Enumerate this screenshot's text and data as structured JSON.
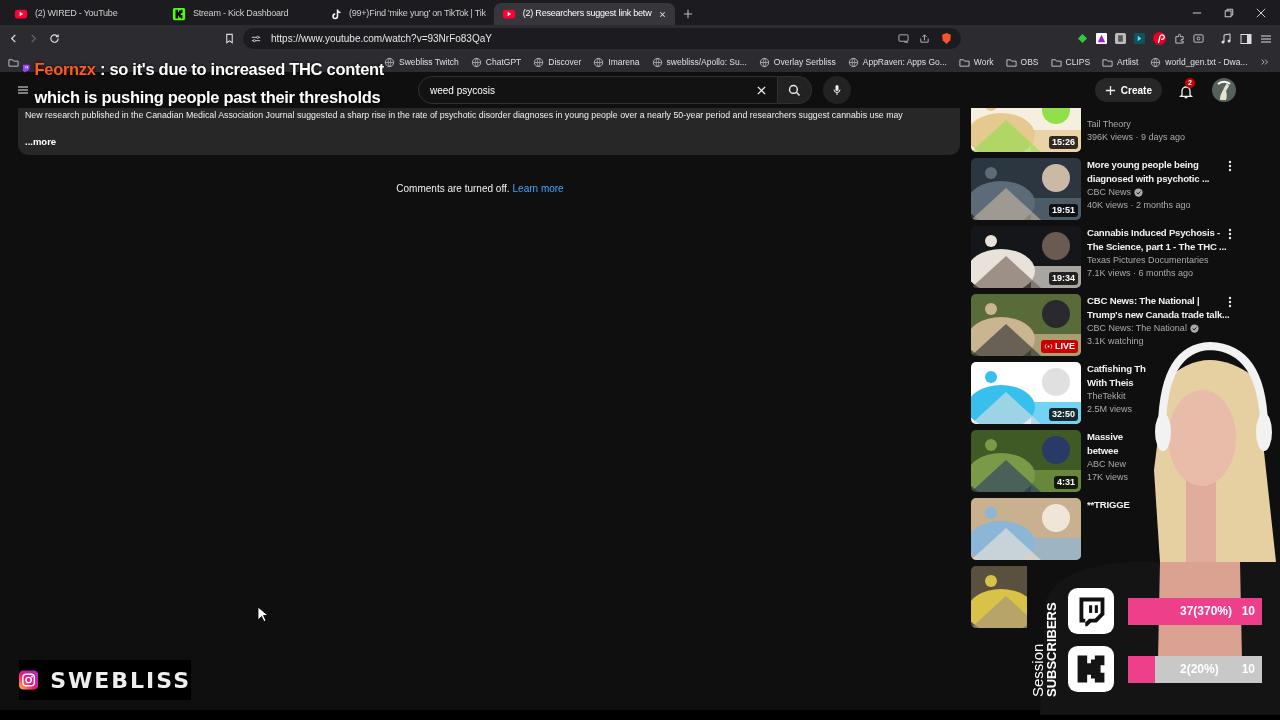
{
  "browser": {
    "tabs": [
      {
        "title": "(2) WIRED - YouTube",
        "selected": false
      },
      {
        "title": "Stream - Kick Dashboard",
        "selected": false
      },
      {
        "title": "(99+)Find 'mike yung' on TikTok | Tik",
        "selected": false
      },
      {
        "title": "(2) Researchers suggest link betw",
        "selected": true
      }
    ],
    "url": "https://www.youtube.com/watch?v=93NrFo83QaY",
    "bookmarks": [
      {
        "label": "Swebliss Twitch",
        "kind": "link"
      },
      {
        "label": "ChatGPT",
        "kind": "link"
      },
      {
        "label": "Discover",
        "kind": "link"
      },
      {
        "label": "Imarena",
        "kind": "link"
      },
      {
        "label": "swebliss/Apollo: Su...",
        "kind": "link"
      },
      {
        "label": "Overlay Serbliss",
        "kind": "link"
      },
      {
        "label": "AppRaven: Apps Go...",
        "kind": "link"
      },
      {
        "label": "Work",
        "kind": "folder"
      },
      {
        "label": "OBS",
        "kind": "folder"
      },
      {
        "label": "CLIPS",
        "kind": "folder"
      },
      {
        "label": "Artlist",
        "kind": "folder"
      },
      {
        "label": "world_gen.txt - Dwa...",
        "kind": "link"
      }
    ]
  },
  "chat_overlay": {
    "username": "Feornzx",
    "message": ": so it's due to increased THC content which is pushing people past their thresholds"
  },
  "youtube": {
    "search": {
      "value": "weed psycosis"
    },
    "create": "Create",
    "notifications": "2",
    "description": {
      "text": "New research published in the Canadian Medical Association Journal suggested a sharp rise in the rate of psychotic disorder diagnoses in young people over a nearly 50-year period and researchers suggest cannabis use may",
      "more": "...more"
    },
    "comments": {
      "text": "Comments are turned off.",
      "link": "Learn more"
    },
    "related": [
      {
        "channel": "Tail Theory",
        "verified": false,
        "meta": "396K views · 9 days ago",
        "duration": "15:26",
        "menu": false
      },
      {
        "title": "More young people being\ndiagnosed with psychotic ...",
        "channel": "CBC News",
        "verified": true,
        "meta": "40K views · 2 months ago",
        "duration": "19:51",
        "menu": true
      },
      {
        "title": "Cannabis Induced Psychosis -\nThe Science, part 1 - The THC ...",
        "channel": "Texas Pictures Documentaries",
        "verified": false,
        "meta": "7.1K views · 6 months ago",
        "duration": "19:34",
        "menu": true
      },
      {
        "title": "CBC News: The National |\nTrump's new Canada trade talk...",
        "channel": "CBC News: The National",
        "verified": true,
        "meta": "3.1K watching",
        "live_label": "LIVE",
        "menu": true
      },
      {
        "title": "Catfishing Th\nWith Theis",
        "channel": "TheTekkit",
        "verified": false,
        "meta": "2.5M views",
        "duration": "32:50",
        "menu": false
      },
      {
        "title": "Massive\nbetwee",
        "channel": "ABC New",
        "verified": false,
        "meta": "17K views",
        "duration": "4:31",
        "menu": false
      },
      {
        "title": "**TRIGGE",
        "verified": false,
        "menu": false
      },
      {
        "verified": false,
        "menu": false
      }
    ]
  },
  "subscribers": {
    "label": "Session",
    "title": "SUBSCRIBERS",
    "goals": [
      {
        "reading": "37(370%)",
        "target": "10",
        "level": 1
      },
      {
        "reading": "2(20%)",
        "target": "10",
        "level": 0.2
      }
    ]
  },
  "instagram": {
    "handle": "SWEBLISS"
  }
}
